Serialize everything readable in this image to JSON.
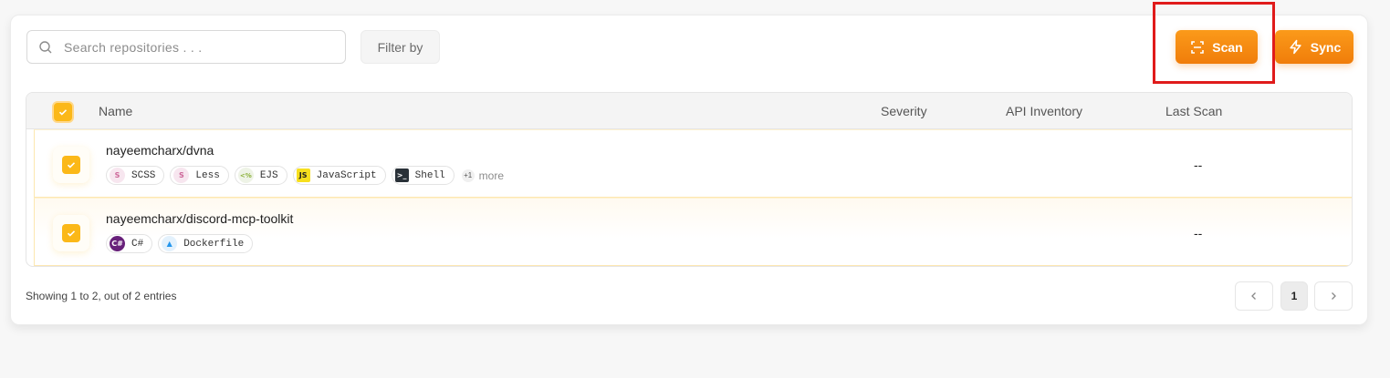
{
  "search": {
    "placeholder": "Search repositories . . ."
  },
  "toolbar": {
    "filter_label": "Filter by",
    "scan_label": "Scan",
    "sync_label": "Sync"
  },
  "table": {
    "columns": {
      "name": "Name",
      "severity": "Severity",
      "api_inventory": "API Inventory",
      "last_scan": "Last Scan"
    },
    "rows": [
      {
        "name": "nayeemcharx/dvna",
        "tags": [
          "SCSS",
          "Less",
          "EJS",
          "JavaScript",
          "Shell"
        ],
        "more_count": "+1",
        "more_label": "more",
        "last_scan": "--"
      },
      {
        "name": "nayeemcharx/discord-mcp-toolkit",
        "tags": [
          "C#",
          "Dockerfile"
        ],
        "last_scan": "--"
      }
    ]
  },
  "footer": {
    "showing": "Showing 1 to 2, out of 2 entries",
    "page": "1"
  },
  "colors": {
    "accent": "#f58a12",
    "checkbox": "#fbb818",
    "highlight": "#e01b1b"
  }
}
